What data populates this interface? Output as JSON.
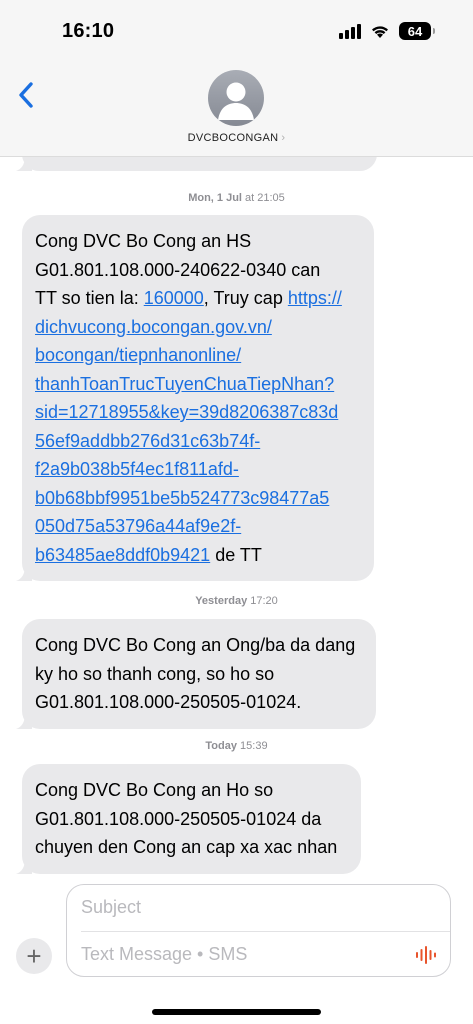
{
  "status_bar": {
    "time": "16:10",
    "battery": "64"
  },
  "header": {
    "contact_name": "DVCBOCONGAN",
    "contact_chevron": "›"
  },
  "messages": [
    {
      "timestamp_day": "Mon, 1 Jul",
      "timestamp_time": "at 21:05",
      "lines": [
        [
          {
            "t": "Cong DVC Bo Cong an HS"
          }
        ],
        [
          {
            "t": "G01.801.108.000-240622-0340 can"
          }
        ],
        [
          {
            "t": "TT so tien la: "
          },
          {
            "t": "160000",
            "link": true
          },
          {
            "t": ", Truy cap "
          },
          {
            "t": "https://",
            "link": true
          }
        ],
        [
          {
            "t": "dichvucong.bocongan.gov.vn/",
            "link": true
          }
        ],
        [
          {
            "t": "bocongan/tiepnhanonline/",
            "link": true
          }
        ],
        [
          {
            "t": "thanhToanTrucTuyenChuaTiepNhan?",
            "link": true
          }
        ],
        [
          {
            "t": "sid=12718955&key=39d8206387c83d",
            "link": true
          }
        ],
        [
          {
            "t": "56ef9addbb276d31c63b74f-",
            "link": true
          }
        ],
        [
          {
            "t": "f2a9b038b5f4ec1f811afd-",
            "link": true
          }
        ],
        [
          {
            "t": "b0b68bbf9951be5b524773c98477a5",
            "link": true
          }
        ],
        [
          {
            "t": "050d75a53796a44af9e2f-",
            "link": true
          }
        ],
        [
          {
            "t": "b63485ae8ddf0b9421",
            "link": true
          },
          {
            "t": " de TT"
          }
        ]
      ]
    },
    {
      "timestamp_day": "Yesterday",
      "timestamp_time": "17:20",
      "lines": [
        [
          {
            "t": "Cong DVC Bo Cong an Ong/ba da dang"
          }
        ],
        [
          {
            "t": "ky ho so thanh cong, so ho so"
          }
        ],
        [
          {
            "t": "G01.801.108.000-250505-01024."
          }
        ]
      ]
    },
    {
      "timestamp_day": "Today",
      "timestamp_time": "15:39",
      "lines": [
        [
          {
            "t": "Cong DVC Bo Cong an Ho so"
          }
        ],
        [
          {
            "t": "G01.801.108.000-250505-01024 da"
          }
        ],
        [
          {
            "t": "chuyen den Cong an cap xa xac nhan"
          }
        ]
      ]
    }
  ],
  "composer": {
    "subject_placeholder": "Subject",
    "message_placeholder": "Text Message • SMS",
    "plus_label": "+"
  },
  "icons": {
    "back": "chevron-left-icon",
    "mic": "waveform-icon",
    "wifi": "wifi-icon",
    "signal": "cellular-signal-icon",
    "battery": "battery-icon"
  },
  "colors": {
    "link": "#1a6fe0",
    "bubble": "#e9e9eb",
    "back_arrow": "#1a6fe0",
    "mic": "#e8542c"
  }
}
